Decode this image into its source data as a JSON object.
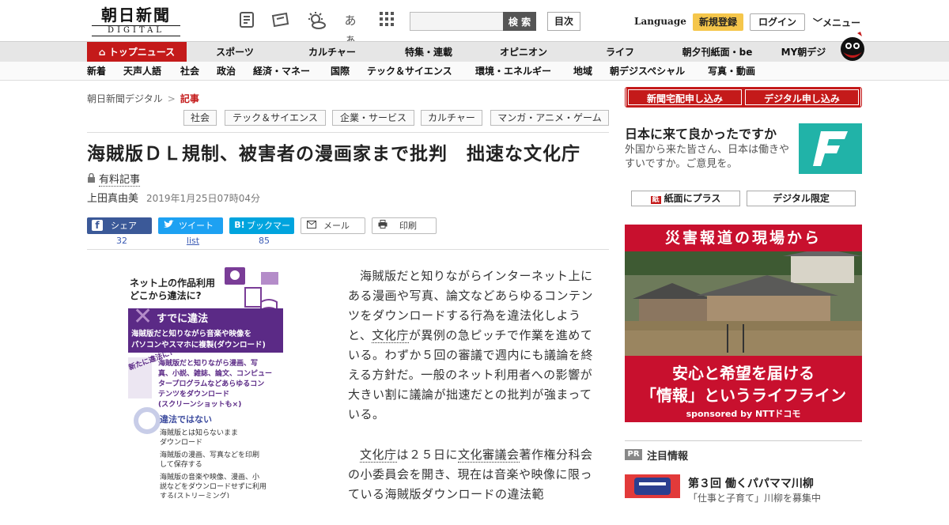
{
  "header": {
    "logo_main": "朝日新聞",
    "logo_sub": "DIGITAL",
    "icons": [
      "paper-icon",
      "news-icon",
      "weather-icon",
      "font-size-icon",
      "grid-icon"
    ],
    "font_size_label": "あぁ",
    "search_placeholder": "",
    "search_button": "検 索",
    "toc_button": "目次",
    "language": "Language",
    "signup": "新規登録",
    "login": "ログイン",
    "menu": "メニュー"
  },
  "nav_primary": [
    "トップニュース",
    "スポーツ",
    "カルチャー",
    "特集・連載",
    "オピニオン",
    "ライフ",
    "朝夕刊紙面・be",
    "MY朝デジ"
  ],
  "nav_secondary": [
    "新着",
    "天声人語",
    "社会",
    "政治",
    "経済・マネー",
    "国際",
    "テック＆サイエンス",
    "環境・エネルギー",
    "地域",
    "朝デジスペシャル",
    "写真・動画"
  ],
  "breadcrumb": {
    "home": "朝日新聞デジタル",
    "sep": ">",
    "current": "記事"
  },
  "tags": [
    "社会",
    "テック＆サイエンス",
    "企業・サービス",
    "カルチャー",
    "マンガ・アニメ・ゲーム"
  ],
  "article": {
    "headline": "海賊版ＤＬ規制、被害者の漫画家まで批判　拙速な文化庁",
    "paid_label": "有料記事",
    "author": "上田真由美",
    "date": "2019年1月25日07時04分",
    "p1_a": "海賊版だと知りながらインターネット上にある漫画や写真、論文などあらゆるコンテンツをダウンロードする行為を違法化しようと、",
    "p1_link": "文化庁",
    "p1_b": "が異例の急ピッチで作業を進めている。わずか５回の審議で週内にも議論を終える方針だ。一般のネット利用者への影響が大きい割に議論が拙速だとの批判が強まっている。",
    "p2_link1": "文化庁",
    "p2_a": "は２５日に",
    "p2_link2": "文化審議会",
    "p2_b": "著作権分科会の小委員会を開き、現在は音楽や映像に限っている海賊版ダウンロードの違法範"
  },
  "share": {
    "facebook": "シェア",
    "facebook_count": "32",
    "twitter": "ツイート",
    "twitter_count": "list",
    "hatena": "ブックマーク",
    "hatena_icon": "B!",
    "hatena_count": "85",
    "mail": "メール",
    "print": "印刷"
  },
  "figure": {
    "title1": "ネット上の作品利用",
    "title2": "どこから違法に?",
    "already_head": "すでに違法",
    "already_text1": "海賊版だと知りながら音楽や映像を",
    "already_text2": "パソコンやスマホに複製(ダウンロード)",
    "new_label": "新たに違法に?",
    "new_items": [
      "海賊版だと知りながら漫画、写",
      "真、小説、雑誌、論文、コンピュー",
      "タープログラムなどあらゆるコン",
      "テンツをダウンロード",
      "(スクリーンショットも×)"
    ],
    "legal_head": "違法ではない",
    "legal_items": [
      "海賊版とは知らないまま",
      "ダウンロード",
      "海賊版の漫画、写真などを印刷",
      "して保存する",
      "海賊版の音楽や映像、漫画、小",
      "説などをダウンロードせずに利用",
      "する(ストリーミング)"
    ]
  },
  "sidebar": {
    "btn_paper": "新聞宅配申し込み",
    "btn_digital": "デジタル申し込み",
    "promo_title": "日本に来て良かったですか",
    "promo_text": "外国から来た皆さん、日本は働きやすいですか。ご意見を。",
    "paper_plus": "紙面にプラス",
    "paper_plus_icon": "紙",
    "digital_only": "デジタル限定",
    "ad_head": "災害報道の現場から",
    "ad_line1": "安心と希望を届ける",
    "ad_line2": "「情報」というライフライン",
    "ad_sponsor": "sponsored by NTTドコモ",
    "pr_badge": "PR",
    "pr_label": "注目情報",
    "pr_title": "第３回 働くパパママ川柳",
    "pr_sub": "「仕事と子育て」川柳を募集中"
  },
  "colors": {
    "accent": "#c41a1a",
    "signup": "#f5c64b",
    "facebook": "#3b5998",
    "twitter": "#1da1f2",
    "hatena": "#00a4de",
    "promo": "#21b3a8"
  }
}
